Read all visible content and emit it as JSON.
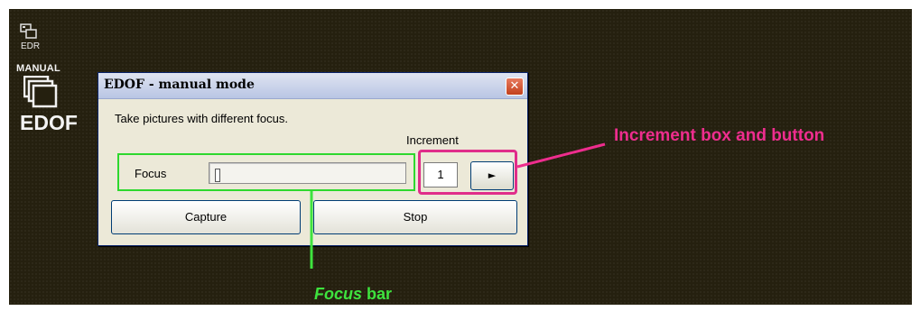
{
  "mode_panel": {
    "edr_label": "EDR",
    "manual_label": "MANUAL",
    "edof_label": "EDOF",
    "icons": [
      "edr-mode-icon",
      "manual-stack-icon"
    ]
  },
  "dialog": {
    "title": "EDOF - manual mode",
    "close_glyph": "✕",
    "description": "Take pictures with different focus.",
    "increment_label": "Increment",
    "focus_label": "Focus",
    "focus_level": 0.0,
    "increment_value": "1",
    "increment_button_glyph": "►",
    "capture_label": "Capture",
    "stop_label": "Stop"
  },
  "annotations": {
    "increment_note": "Increment box and button",
    "focus_note_italic": "Focus",
    "focus_note_rest": " bar",
    "colors": {
      "pink": "#ee2d8e",
      "green": "#3ee33e"
    }
  },
  "colors": {
    "background": "#25200f",
    "dialog_face": "#ece9d8",
    "close_button": "#c2401c"
  }
}
